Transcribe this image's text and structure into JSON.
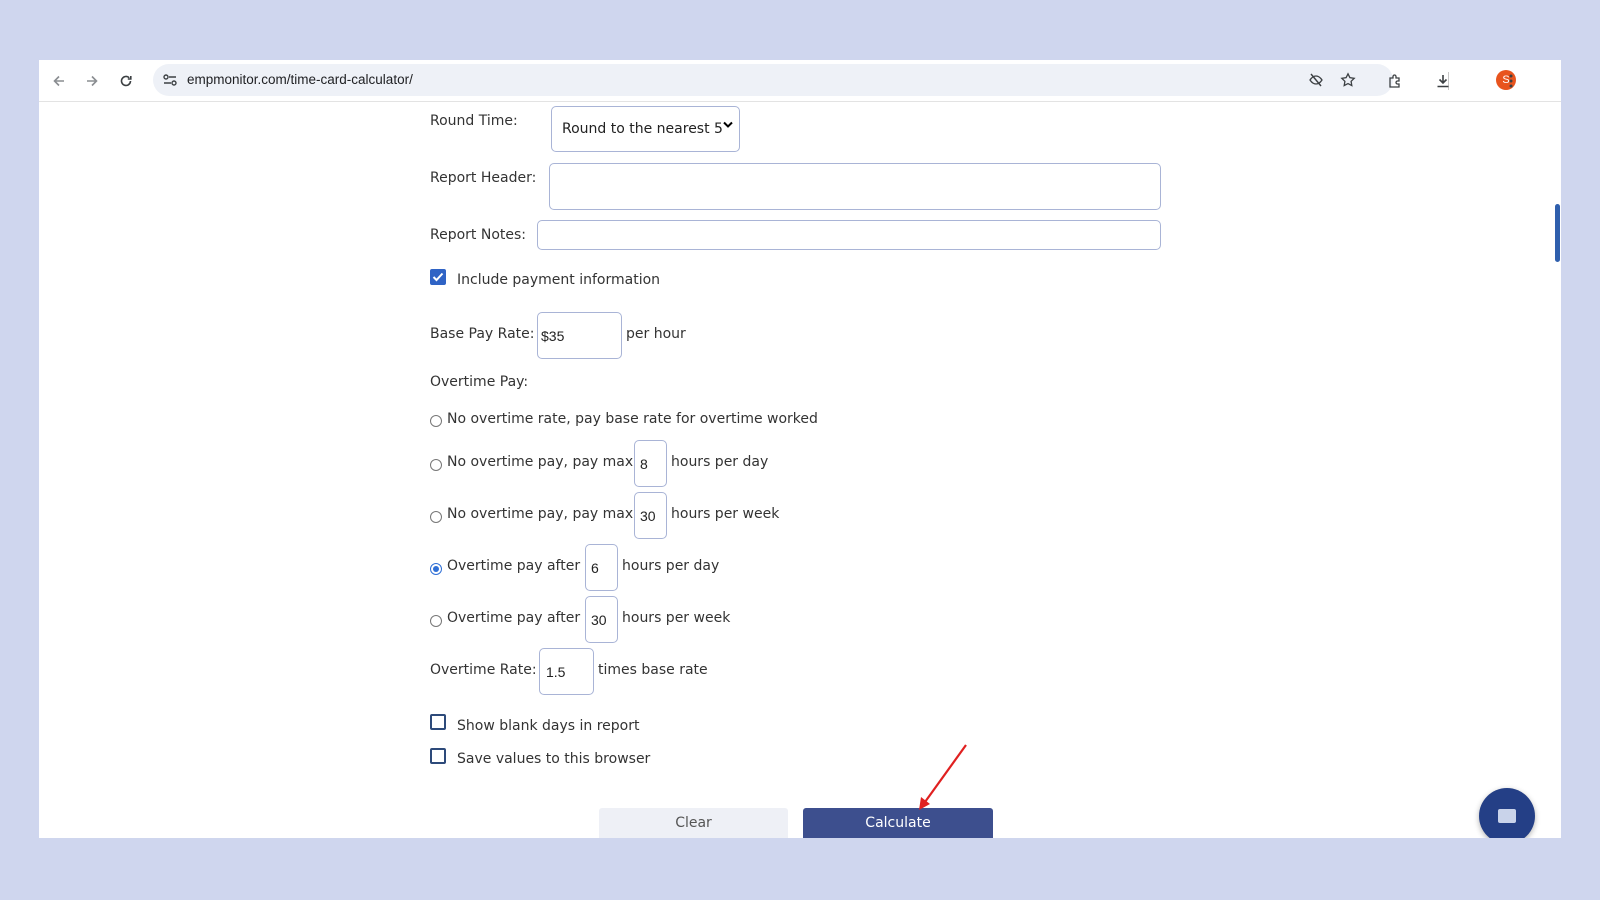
{
  "browser": {
    "url": "empmonitor.com/time-card-calculator/",
    "profile_initial": "S",
    "icons": [
      "back-icon",
      "forward-icon",
      "reload-icon",
      "site-info-icon",
      "eye-off-icon",
      "star-icon",
      "extensions-icon",
      "download-icon",
      "kebab-menu-icon"
    ]
  },
  "form": {
    "round_time_label": "Round Time:",
    "round_time_value": "Round to the nearest 5",
    "report_header_label": "Report Header:",
    "report_header_value": "",
    "report_notes_label": "Report Notes:",
    "report_notes_value": "",
    "include_payment_label": "Include payment information",
    "include_payment_checked": true,
    "base_pay_label": "Base Pay Rate:",
    "base_pay_value": "$35",
    "base_pay_suffix": "per hour",
    "overtime_pay_label": "Overtime Pay:",
    "overtime_options": [
      {
        "pre": "No overtime rate, pay base rate for overtime worked",
        "value": "",
        "post": "",
        "selected": false
      },
      {
        "pre": "No overtime pay, pay max",
        "value": "8",
        "post": "hours per day",
        "selected": false
      },
      {
        "pre": "No overtime pay, pay max",
        "value": "30",
        "post": "hours per week",
        "selected": false
      },
      {
        "pre": "Overtime pay after",
        "value": "6",
        "post": "hours per day",
        "selected": true
      },
      {
        "pre": "Overtime pay after",
        "value": "30",
        "post": "hours per week",
        "selected": false
      }
    ],
    "overtime_rate_label": "Overtime Rate:",
    "overtime_rate_value": "1.5",
    "overtime_rate_suffix": "times base rate",
    "show_blank_label": "Show blank days in report",
    "show_blank_checked": false,
    "save_values_label": "Save values to this browser",
    "save_values_checked": false,
    "clear_label": "Clear",
    "calculate_label": "Calculate"
  },
  "colors": {
    "page_bg": "#cfd6ee",
    "accent": "#3d4f8e",
    "checkbox_blue": "#2f63c5",
    "annotation_arrow": "#e02020"
  }
}
